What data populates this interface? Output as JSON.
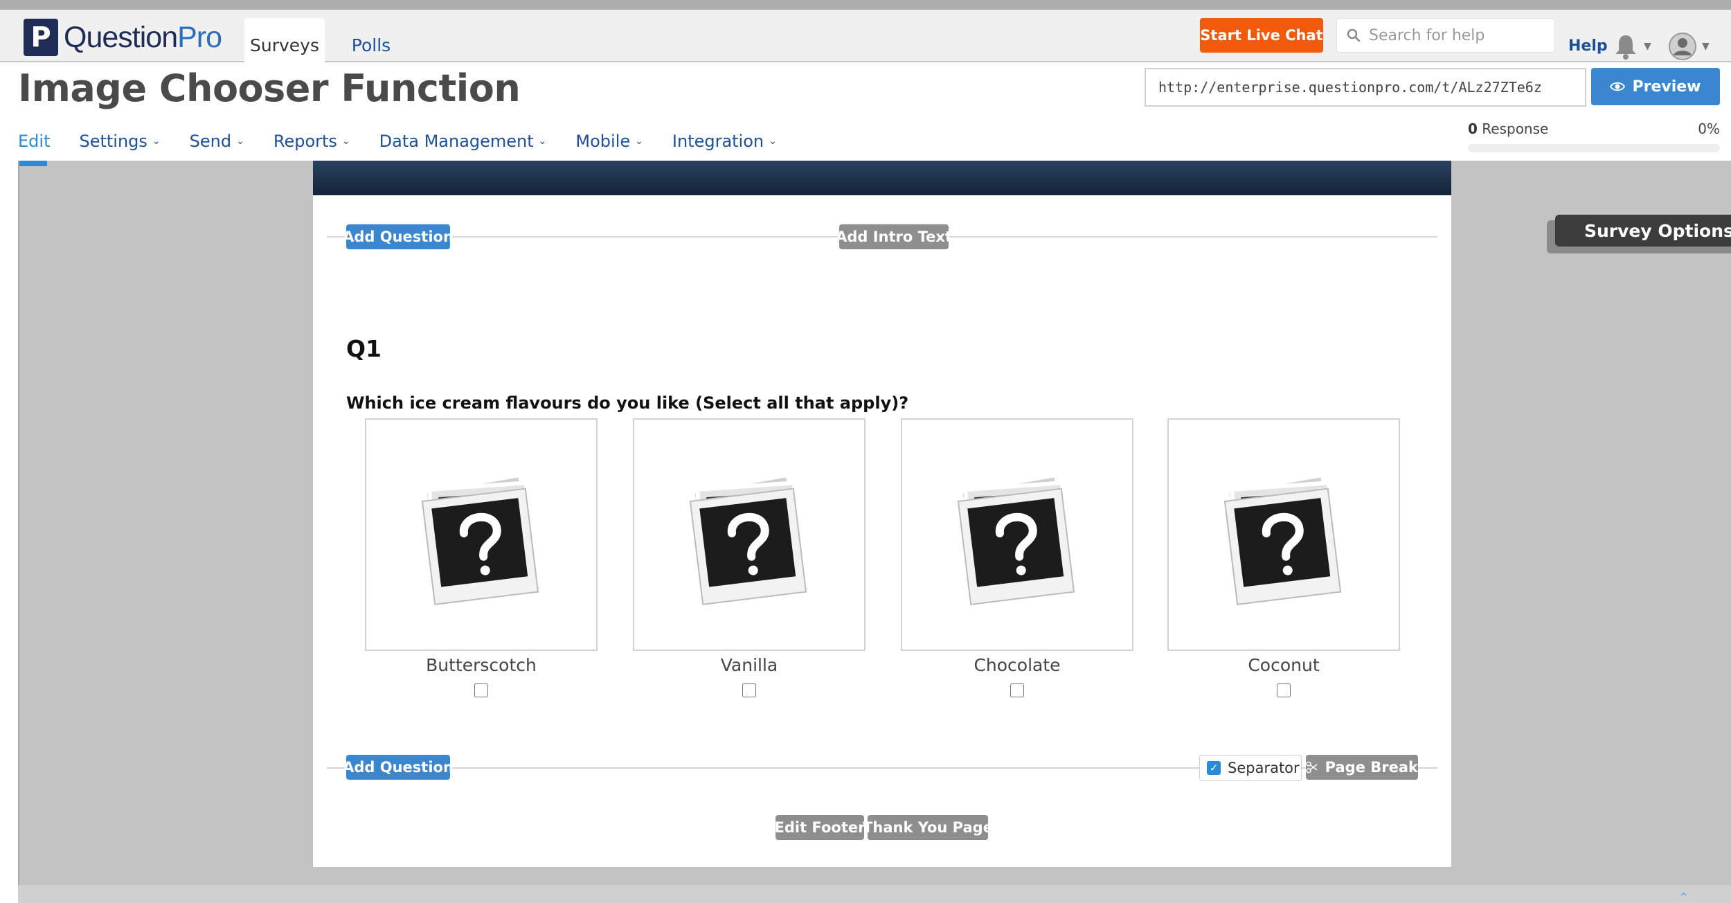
{
  "topbar": {
    "logo": {
      "mark": "P",
      "text_a": "Question",
      "text_b": "Pro"
    },
    "tabs": [
      {
        "label": "Surveys",
        "active": true
      },
      {
        "label": "Polls",
        "active": false
      }
    ],
    "live_chat_label": "Start Live Chat",
    "search_placeholder": "Search for help",
    "help_label": "Help",
    "bell_icon": "bell-icon",
    "avatar_icon": "user-avatar-icon"
  },
  "title": "Image Chooser Function",
  "survey_url": "http://enterprise.questionpro.com/t/ALz27ZTe6z",
  "preview_label": "Preview",
  "subnav": [
    {
      "label": "Edit",
      "active": true,
      "has_dropdown": false
    },
    {
      "label": "Settings",
      "active": false,
      "has_dropdown": true
    },
    {
      "label": "Send",
      "active": false,
      "has_dropdown": true
    },
    {
      "label": "Reports",
      "active": false,
      "has_dropdown": true
    },
    {
      "label": "Data Management",
      "active": false,
      "has_dropdown": true
    },
    {
      "label": "Mobile",
      "active": false,
      "has_dropdown": true
    },
    {
      "label": "Integration",
      "active": false,
      "has_dropdown": true
    }
  ],
  "responses": {
    "count": "0",
    "label": "Response",
    "percent": "0%",
    "progress": 0
  },
  "survey": {
    "add_question_label": "Add Question",
    "add_intro_label": "Add Intro Text",
    "question_number": "Q1",
    "question_text": "Which ice cream flavours do you like (Select all that apply)?",
    "choices": [
      {
        "label": "Butterscotch",
        "checked": false,
        "icon": "missing-image-icon"
      },
      {
        "label": "Vanilla",
        "checked": false,
        "icon": "missing-image-icon"
      },
      {
        "label": "Chocolate",
        "checked": false,
        "icon": "missing-image-icon"
      },
      {
        "label": "Coconut",
        "checked": false,
        "icon": "missing-image-icon"
      }
    ],
    "separator_label": "Separator",
    "separator_checked": true,
    "page_break_label": "Page Break",
    "edit_footer_label": "Edit Footer",
    "thank_you_label": "Thank You Page"
  },
  "survey_options_label": "Survey Options",
  "colors": {
    "brand_navy": "#1f2c55",
    "link_blue": "#1c4f9c",
    "primary_blue": "#3b87cf",
    "chat_orange": "#f35a0c",
    "secondary_gray": "#8e8e8e"
  }
}
